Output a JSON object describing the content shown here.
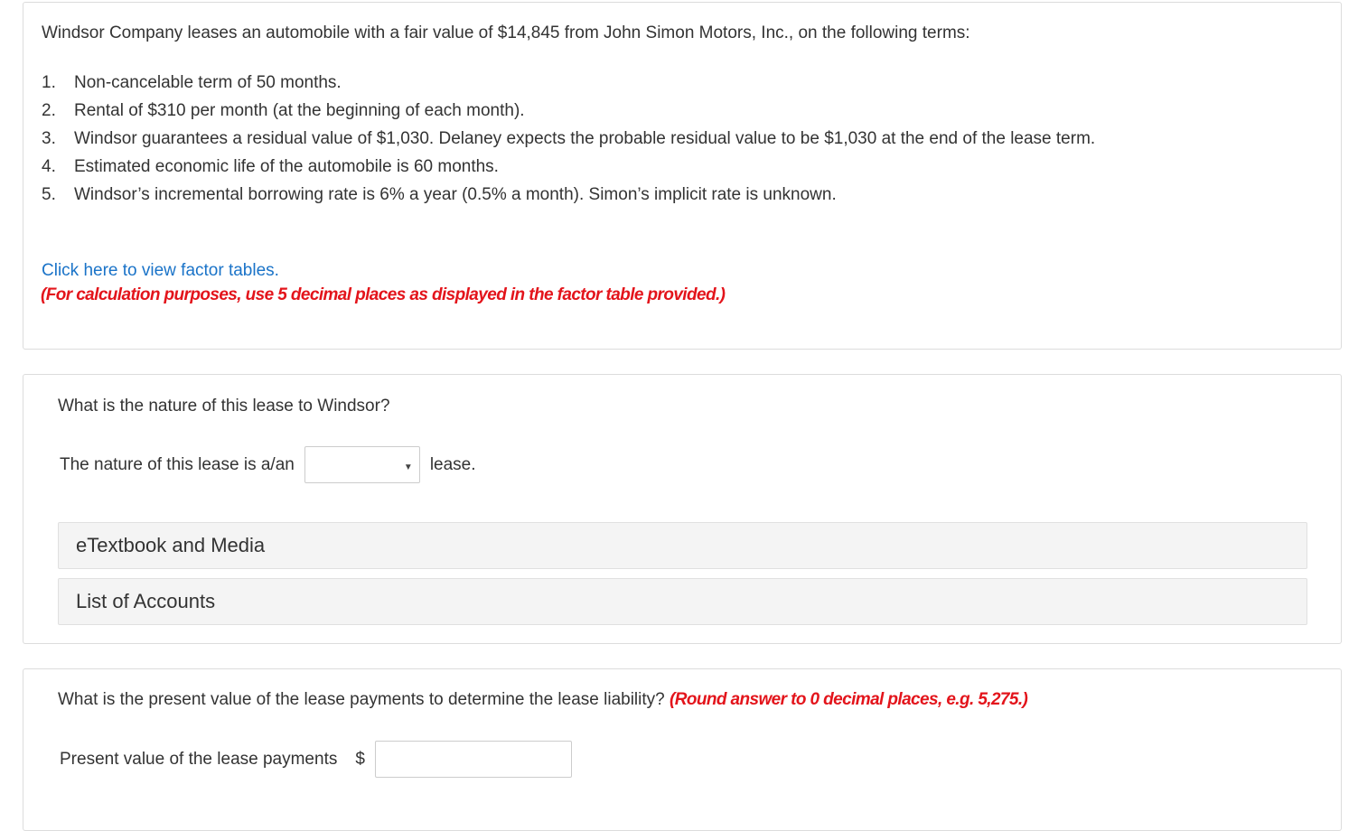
{
  "problem": {
    "intro": "Windsor Company leases an automobile with a fair value of $14,845 from John Simon Motors, Inc., on the following terms:",
    "terms": [
      {
        "num": "1.",
        "text": "Non-cancelable term of 50 months."
      },
      {
        "num": "2.",
        "text": "Rental of $310 per month (at the beginning of each month)."
      },
      {
        "num": "3.",
        "text": "Windsor guarantees a residual value of $1,030. Delaney expects the probable residual value to be $1,030 at the end of the lease term."
      },
      {
        "num": "4.",
        "text": "Estimated economic life of the automobile is 60 months."
      },
      {
        "num": "5.",
        "text": "Windsor’s incremental borrowing rate is 6% a year (0.5% a month). Simon’s implicit rate is unknown."
      }
    ],
    "factor_link": "Click here to view factor tables.",
    "calc_note": "(For calculation purposes, use 5 decimal places as displayed in the factor table provided.)"
  },
  "part1": {
    "question": "What is the nature of this lease to Windsor?",
    "prefix": "The nature of this lease is a/an",
    "select_value": "",
    "caret": "▼",
    "suffix": "lease.",
    "etextbook": "eTextbook and Media",
    "accounts": "List of Accounts"
  },
  "part2": {
    "question": "What is the present value of the lease payments to determine the lease liability?",
    "rounding_note": "(Round answer to 0 decimal places, e.g. 5,275.)",
    "label": "Present value of the lease payments",
    "currency": "$",
    "value": ""
  }
}
